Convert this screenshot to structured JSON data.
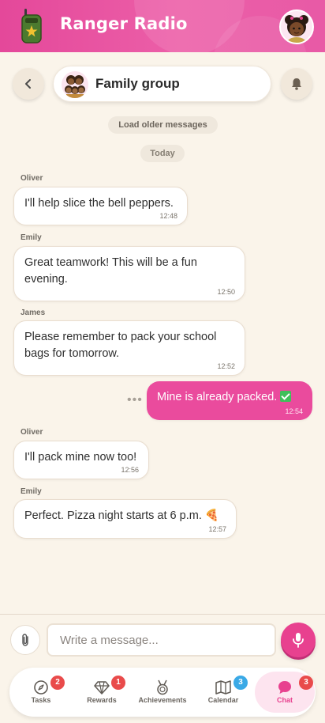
{
  "app": {
    "title": "Ranger Radio",
    "accent_color": "#e8418f",
    "logo_icon": "walkie-talkie-icon",
    "profile_icon": "user-avatar"
  },
  "chat_header": {
    "group_name": "Family group",
    "back_icon": "chevron-left-icon",
    "bell_icon": "bell-icon"
  },
  "load_older_label": "Load older messages",
  "day_separator": "Today",
  "messages": [
    {
      "sender": "Oliver",
      "text": "I'll help slice the bell peppers.",
      "time": "12:48",
      "mine": false
    },
    {
      "sender": "Emily",
      "text": "Great teamwork! This will be a fun evening.",
      "time": "12:50",
      "mine": false
    },
    {
      "sender": "James",
      "text": "Please remember to pack your school bags for tomorrow.",
      "time": "12:52",
      "mine": false
    },
    {
      "sender": "",
      "text": "Mine is already packed.",
      "emoji": "check-mark-icon",
      "time": "12:54",
      "mine": true
    },
    {
      "sender": "Oliver",
      "text": "I'll pack mine now too!",
      "time": "12:56",
      "mine": false
    },
    {
      "sender": "Emily",
      "text": "Perfect. Pizza night starts at 6 p.m. 🍕",
      "time": "12:57",
      "mine": false
    }
  ],
  "composer": {
    "placeholder": "Write a message...",
    "attach_icon": "paperclip-icon",
    "mic_icon": "microphone-icon"
  },
  "bottom_nav": [
    {
      "label": "Tasks",
      "icon": "compass-icon",
      "badge": "2",
      "badge_color": "#e94b4b",
      "active": false
    },
    {
      "label": "Rewards",
      "icon": "diamond-icon",
      "badge": "1",
      "badge_color": "#e94b4b",
      "active": false
    },
    {
      "label": "Achievements",
      "icon": "medal-icon",
      "badge": "",
      "badge_color": "",
      "active": false
    },
    {
      "label": "Calendar",
      "icon": "map-icon",
      "badge": "3",
      "badge_color": "#3aa9e6",
      "active": false
    },
    {
      "label": "Chat",
      "icon": "chat-bubble-icon",
      "badge": "3",
      "badge_color": "#e94b4b",
      "active": true
    }
  ]
}
